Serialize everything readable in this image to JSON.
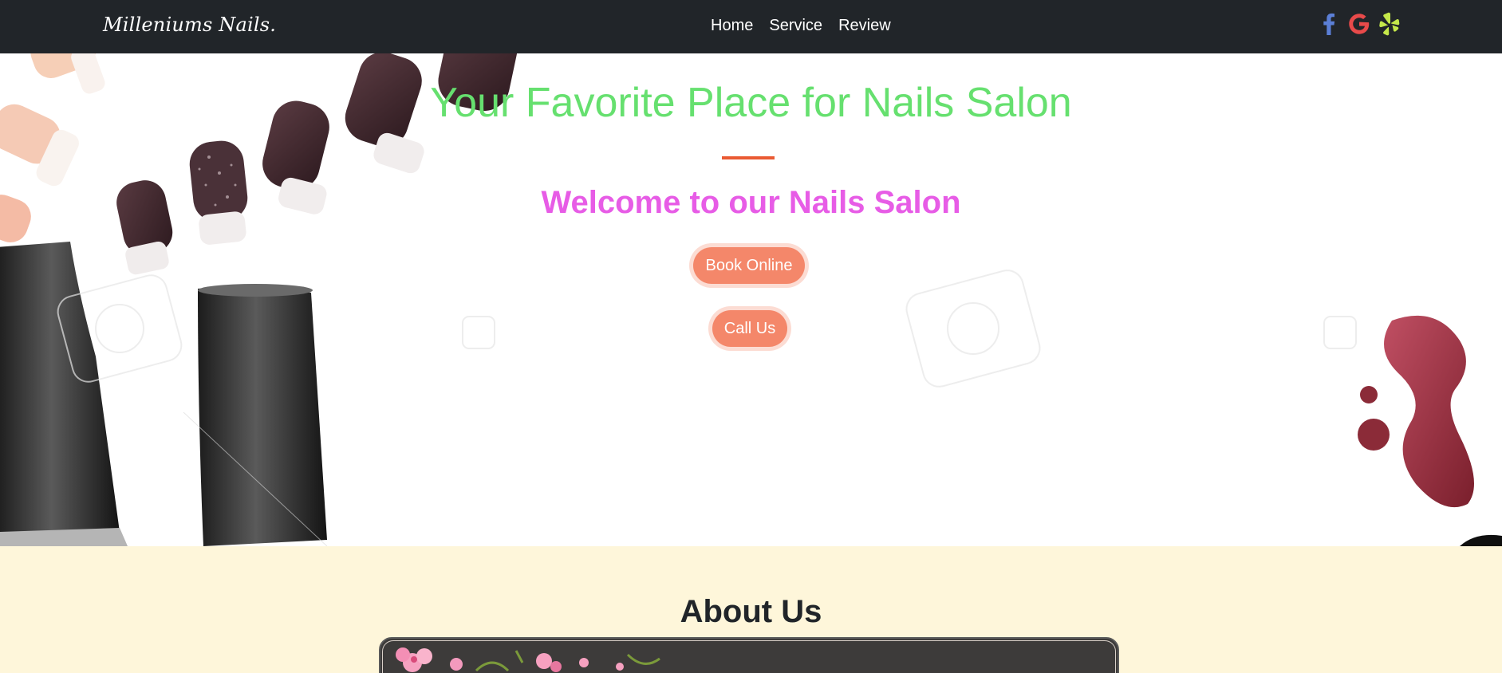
{
  "navbar": {
    "brand": "Milleniums Nails.",
    "links": [
      "Home",
      "Service",
      "Review"
    ],
    "socials": [
      {
        "icon": "facebook-icon",
        "color": "#5b7fd6"
      },
      {
        "icon": "google-icon",
        "color": "#e84a4a"
      },
      {
        "icon": "yelp-icon",
        "color": "#c5e84a"
      }
    ]
  },
  "hero": {
    "title": "Your Favorite Place for Nails Salon",
    "subtitle": "Welcome to our Nails Salon",
    "buttons": {
      "book": "Book Online",
      "call": "Call Us"
    },
    "colors": {
      "title": "#66e06f",
      "subtitle": "#e75ce6",
      "divider": "#ea5a33",
      "button": "#f4876a"
    }
  },
  "about": {
    "title": "About Us",
    "background": "#fef6da"
  }
}
